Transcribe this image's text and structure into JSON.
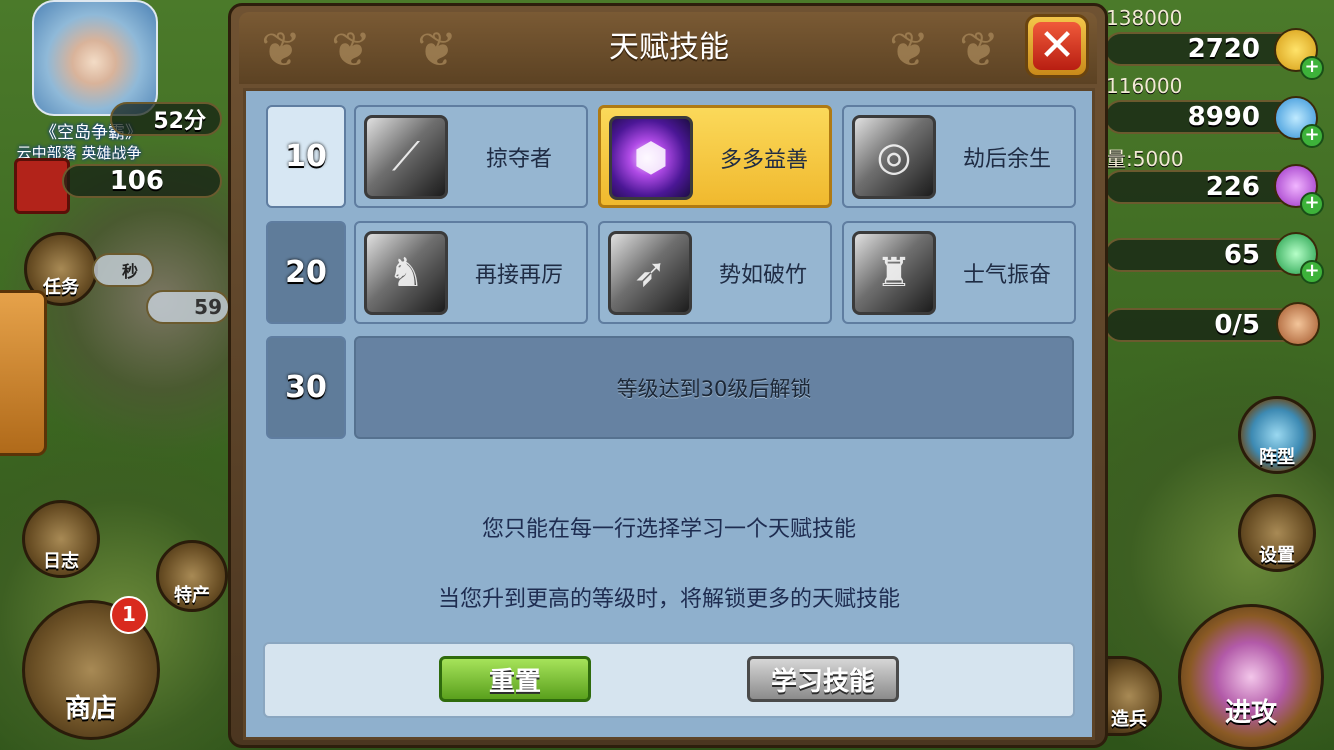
{
  "game": {
    "logo_title": "《空岛争霸》",
    "logo_subtitle": "云中部落 英雄战争",
    "timer_partial": "52分",
    "level": "106",
    "task_label": "任务",
    "seconds_label": "秒",
    "partial_number": "59",
    "log_label": "日志",
    "specialty_label": "特产",
    "shop_label": "商店",
    "shop_badge": "1"
  },
  "resources": {
    "gold_cap": "138000",
    "gold": "2720",
    "water_cap": "116000",
    "water": "8990",
    "capacity_label": "量:5000",
    "purple_gem": "226",
    "green_gem": "65",
    "troops": "0/5"
  },
  "right_buttons": {
    "formation": "阵型",
    "settings": "设置",
    "recruit": "造兵",
    "attack": "进攻"
  },
  "dialog": {
    "title": "天赋技能",
    "close_icon": "close-x-icon",
    "rows": [
      {
        "level": "10",
        "unlocked": true,
        "skills": [
          {
            "name": "掠夺者",
            "icon": "blade-icon",
            "selected": false
          },
          {
            "name": "多多益善",
            "icon": "purple-rune-stone-icon",
            "selected": true
          },
          {
            "name": "劫后余生",
            "icon": "vortex-icon",
            "selected": false
          }
        ]
      },
      {
        "level": "20",
        "unlocked": true,
        "skills": [
          {
            "name": "再接再厉",
            "icon": "winged-warrior-icon",
            "selected": false
          },
          {
            "name": "势如破竹",
            "icon": "charging-warrior-icon",
            "selected": false
          },
          {
            "name": "士气振奋",
            "icon": "knight-helmet-icon",
            "selected": false
          }
        ]
      },
      {
        "level": "30",
        "unlocked": false
      }
    ],
    "locked_text": "等级达到30级后解锁",
    "info1": "您只能在每一行选择学习一个天赋技能",
    "info2": "当您升到更高的等级时，将解锁更多的天赋技能",
    "reset_label": "重置",
    "learn_label": "学习技能"
  },
  "colors": {
    "selected_skill": "#f6c93e",
    "panel_bg": "#8fb0cd",
    "reset_button": "#7cc23a",
    "close_button": "#e0381f"
  }
}
